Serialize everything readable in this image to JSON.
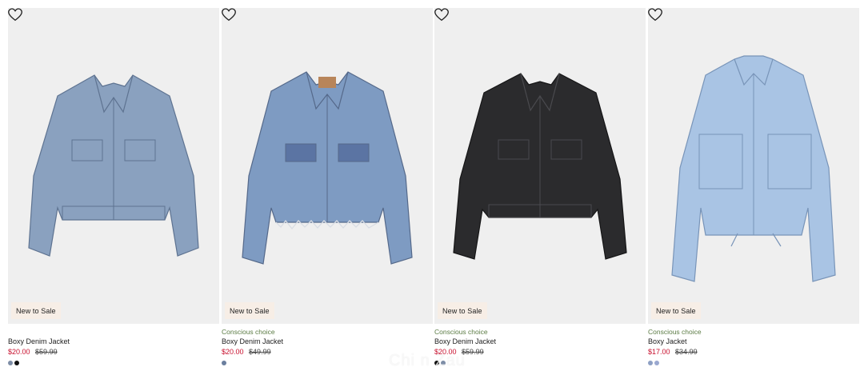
{
  "products": [
    {
      "badge": "New to Sale",
      "eco_label": "",
      "name": "Boxy Denim Jacket",
      "price": "$20.00",
      "old_price": "$59.99",
      "swatches": [
        "#7d8da6",
        "#111111"
      ],
      "jacket_color": "#8aa1bf",
      "favorite_icon": "heart-icon"
    },
    {
      "badge": "New to Sale",
      "eco_label": "Conscious choice",
      "name": "Boxy Denim Jacket",
      "price": "$20.00",
      "old_price": "$49.99",
      "swatches": [
        "#6b7f9e"
      ],
      "jacket_color": "#7e9bc2",
      "favorite_icon": "heart-icon"
    },
    {
      "badge": "New to Sale",
      "eco_label": "Conscious choice",
      "name": "Boxy Denim Jacket",
      "price": "$20.00",
      "old_price": "$59.99",
      "swatches": [
        "#111111",
        "#7d8da6"
      ],
      "jacket_color": "#2b2b2d",
      "favorite_icon": "heart-icon"
    },
    {
      "badge": "New to Sale",
      "eco_label": "Conscious choice",
      "name": "Boxy Jacket",
      "price": "$17.00",
      "old_price": "$34.99",
      "swatches": [
        "#8ea0c4",
        "#9aa8d0"
      ],
      "jacket_color": "#a9c4e4",
      "favorite_icon": "heart-icon"
    }
  ],
  "colors": {
    "sale_price": "#c8102e",
    "eco_label": "#5c7c45",
    "badge_bg": "#f7eee6",
    "image_bg": "#efefef"
  },
  "watermark": "Chi  n Zau"
}
